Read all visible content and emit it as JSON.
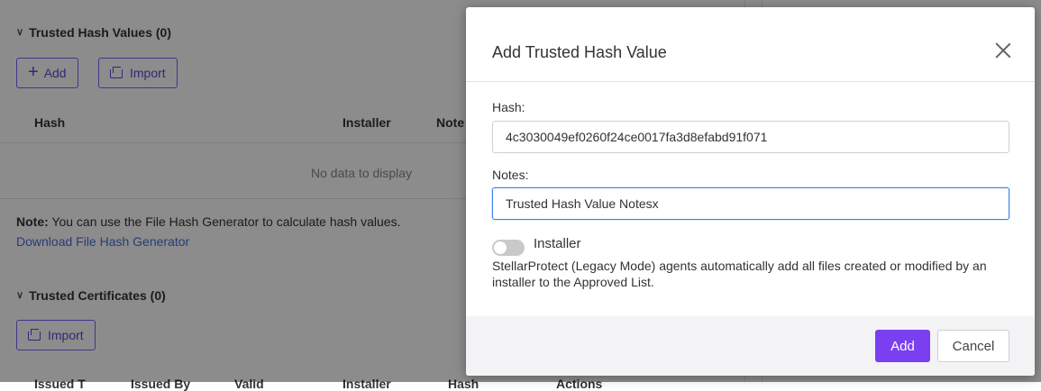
{
  "background": {
    "hash_section": {
      "title": "Trusted Hash Values (0)",
      "add_label": "Add",
      "import_label": "Import",
      "columns": [
        "Hash",
        "Installer",
        "Note"
      ],
      "empty_text": "No data to display",
      "note_bold": "Note:",
      "note_text": " You can use the File Hash Generator to calculate hash values.",
      "download_link": "Download File Hash Generator"
    },
    "cert_section": {
      "title": "Trusted Certificates (0)",
      "import_label": "Import",
      "columns": [
        "Issued T",
        "Issued By",
        "Valid",
        "Installer",
        "Hash",
        "Actions"
      ]
    }
  },
  "modal": {
    "title": "Add Trusted Hash Value",
    "hash_label": "Hash:",
    "hash_value": "4c3030049ef0260f24ce0017fa3d8efabd91f071",
    "notes_label": "Notes:",
    "notes_value": "Trusted Hash Value Notesx",
    "installer_label": "Installer",
    "installer_enabled": false,
    "help_text": "StellarProtect (Legacy Mode) agents automatically add all files created or modified by an installer to the Approved List.",
    "add_button": "Add",
    "cancel_button": "Cancel"
  },
  "colors": {
    "primary": "#7b3ff2",
    "outline": "#7b61ff",
    "focus": "#3d82f0",
    "link": "#4a6fd8"
  }
}
